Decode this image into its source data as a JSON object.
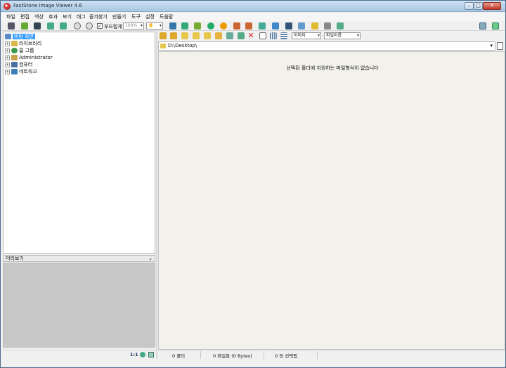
{
  "window": {
    "title": "FastStone Image Viewer 4.6",
    "min": "–",
    "max": "□",
    "close": "✕"
  },
  "menu": [
    "파일",
    "편집",
    "색상",
    "효과",
    "보기",
    "태그",
    "즐겨찾기",
    "만들기",
    "도구",
    "설정",
    "도움말"
  ],
  "toolbar": {
    "smooth_label": "부드럽게",
    "smooth_checked": "✓",
    "zoom_value": "100%"
  },
  "tree": [
    {
      "label": "바탕 화면",
      "selected": true,
      "expand": ""
    },
    {
      "label": "라이브러리",
      "expand": "+"
    },
    {
      "label": "홈 그룹",
      "expand": "+"
    },
    {
      "label": "Administrator",
      "expand": "+"
    },
    {
      "label": "컴퓨터",
      "expand": "+"
    },
    {
      "label": "네트워크",
      "expand": "+"
    }
  ],
  "preview": {
    "title": "미리보기",
    "collapse": "⌄"
  },
  "left_status": {
    "ratio": "1:1"
  },
  "right_toolbar": {
    "filter_value": "이미지",
    "sort_value": "파일이름"
  },
  "path": {
    "value": "D:\\Desktop\\"
  },
  "content": {
    "empty_message": "선택된 폴더에 지원하는 파일형식이 없습니다"
  },
  "status": {
    "folders": "0 폴더",
    "files": "0 파일들 (0 Bytes)",
    "selected": "0 장 선택됨"
  },
  "colors": {
    "selection": "#3399ff",
    "content_bg": "#f2f1ea",
    "preview_bg": "#c8c8c8"
  }
}
